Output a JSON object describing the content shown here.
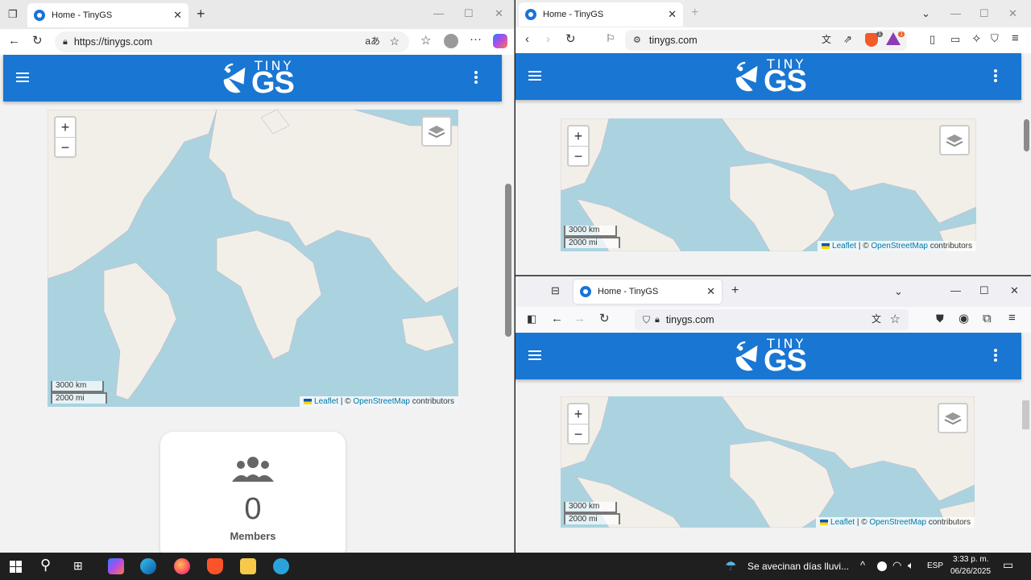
{
  "edge": {
    "tab_title": "Home - TinyGS",
    "new_tab": "+",
    "url": "https://tinygs.com",
    "read_aloud": "aあ"
  },
  "brave": {
    "tab_title": "Home - TinyGS",
    "new_tab": "+",
    "url": "tinygs.com",
    "shield_count": "1",
    "rewards_count": "1"
  },
  "firefox": {
    "tab_title": "Home - TinyGS",
    "new_tab": "+",
    "url": "tinygs.com"
  },
  "site": {
    "logo_top": "TINY",
    "logo_bottom": "GS"
  },
  "map": {
    "zoom_in": "+",
    "zoom_out": "−",
    "scale_km": "3000 km",
    "scale_mi": "2000 mi",
    "attrib_leaflet": "Leaflet",
    "attrib_sep": " | © ",
    "attrib_osm": "OpenStreetMap",
    "attrib_contrib": " contributors"
  },
  "stats": {
    "members_value": "0",
    "members_label": "Members"
  },
  "taskbar": {
    "weather": "Se avecinan días lluvi...",
    "lang": "ESP",
    "time": "3:33 p. m.",
    "date": "06/26/2025"
  },
  "colors": {
    "appbar": "#1976d2",
    "water": "#aad3df",
    "land": "#f2efe9"
  }
}
